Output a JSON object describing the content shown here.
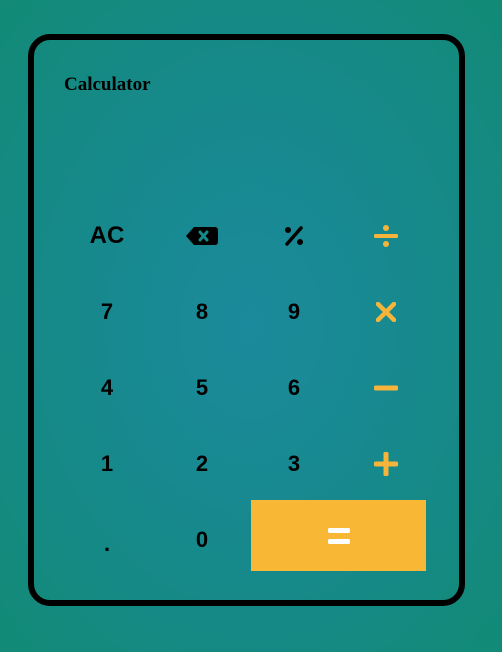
{
  "app": {
    "title": "Calculator",
    "display_value": ""
  },
  "colors": {
    "accent": "#f8b835",
    "operator": "#f6b43b",
    "frame": "#000000",
    "background": "#16898a"
  },
  "keys": {
    "clear": "AC",
    "backspace_icon": "backspace-icon",
    "percent": "%",
    "divide_icon": "divide-icon",
    "seven": "7",
    "eight": "8",
    "nine": "9",
    "multiply_icon": "multiply-icon",
    "four": "4",
    "five": "5",
    "six": "6",
    "subtract_icon": "minus-icon",
    "one": "1",
    "two": "2",
    "three": "3",
    "add_icon": "plus-icon",
    "decimal": ".",
    "zero": "0",
    "equals_icon": "equals-icon"
  }
}
